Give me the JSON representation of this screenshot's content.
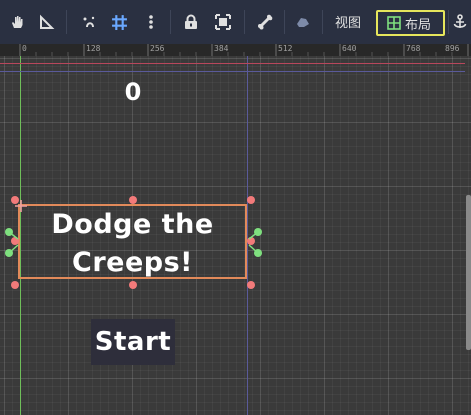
{
  "toolbar": {
    "tools": [
      {
        "icon": "pan-hand-icon"
      },
      {
        "icon": "ruler-tool-icon"
      },
      {
        "icon": "smart-snap-icon"
      },
      {
        "icon": "grid-snap-icon"
      },
      {
        "icon": "more-vertical-icon"
      },
      {
        "icon": "lock-icon"
      },
      {
        "icon": "group-icon"
      },
      {
        "icon": "bone-icon"
      },
      {
        "icon": "skeleton-icon"
      }
    ],
    "view_label": "视图",
    "layout_label": "布局",
    "anchor_icon": "anchor-icon",
    "accent_colors": {
      "layout_highlight": "#e6e65c",
      "snap_active": "#6aa8ff"
    }
  },
  "ruler": {
    "ticks": [
      "0",
      "128",
      "256",
      "384",
      "512",
      "640",
      "768",
      "896"
    ]
  },
  "canvas": {
    "score_label": "0",
    "message_label": "Dodge the Creeps!",
    "start_button_label": "Start",
    "selection_color": "#e28a5a"
  }
}
